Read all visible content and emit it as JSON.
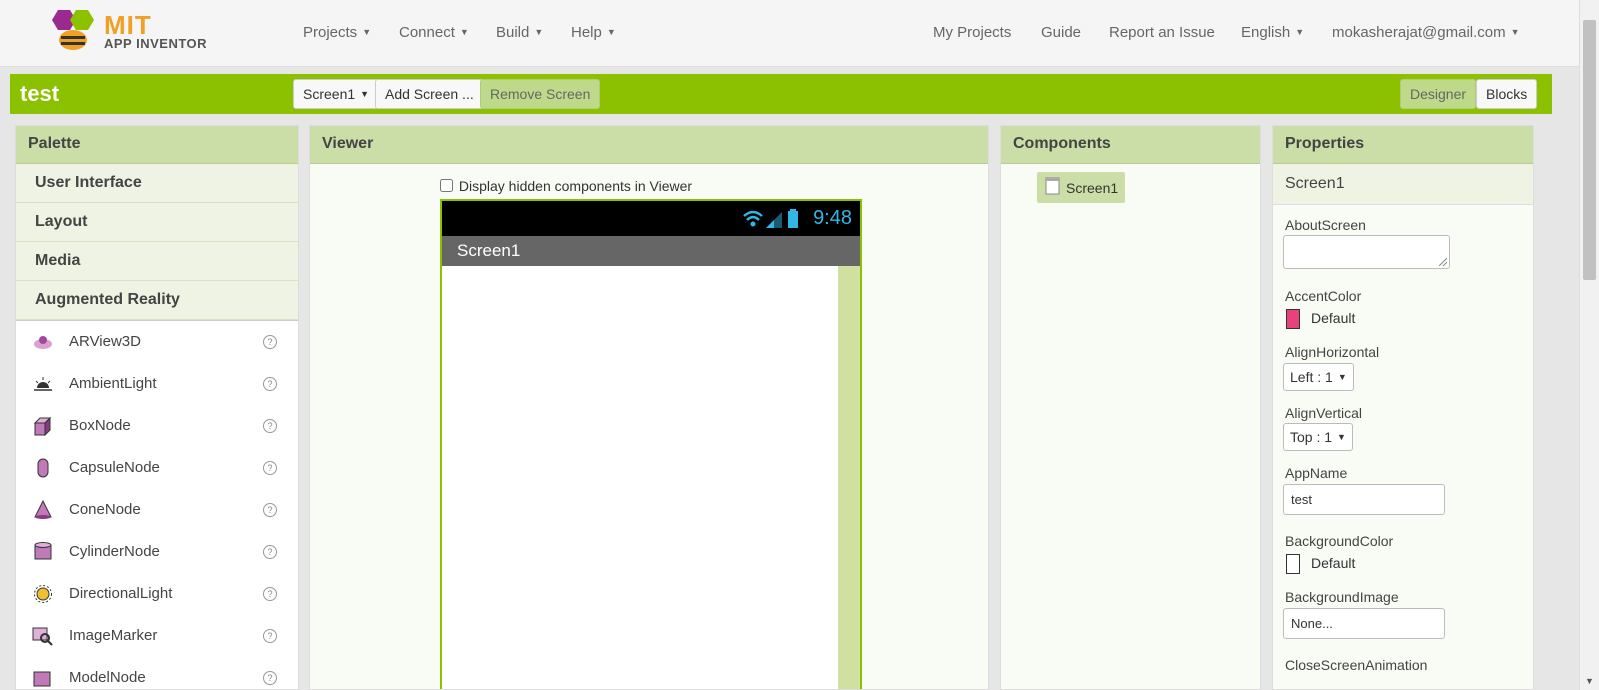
{
  "logo": {
    "line1": "MIT",
    "line2": "APP INVENTOR"
  },
  "nav": {
    "left": [
      "Projects",
      "Connect",
      "Build",
      "Help"
    ],
    "right": {
      "my_projects": "My Projects",
      "guide": "Guide",
      "report": "Report an Issue",
      "language": "English",
      "account": "mokasherajat@gmail.com"
    }
  },
  "project": {
    "title": "test",
    "screen_select": "Screen1",
    "add_screen": "Add Screen ...",
    "remove_screen": "Remove Screen",
    "designer": "Designer",
    "blocks": "Blocks"
  },
  "palette": {
    "title": "Palette",
    "categories": [
      "User Interface",
      "Layout",
      "Media",
      "Augmented Reality"
    ],
    "items": [
      {
        "label": "ARView3D",
        "icon": "arview3d-icon"
      },
      {
        "label": "AmbientLight",
        "icon": "ambientlight-icon"
      },
      {
        "label": "BoxNode",
        "icon": "boxnode-icon"
      },
      {
        "label": "CapsuleNode",
        "icon": "capsulenode-icon"
      },
      {
        "label": "ConeNode",
        "icon": "conenode-icon"
      },
      {
        "label": "CylinderNode",
        "icon": "cylindernode-icon"
      },
      {
        "label": "DirectionalLight",
        "icon": "directionallight-icon"
      },
      {
        "label": "ImageMarker",
        "icon": "imagemarker-icon"
      },
      {
        "label": "ModelNode",
        "icon": "modelnode-icon"
      }
    ],
    "help_glyph": "?"
  },
  "viewer": {
    "title": "Viewer",
    "hidden_label": "Display hidden components in Viewer",
    "clock": "9:48",
    "screen_title": "Screen1"
  },
  "components": {
    "title": "Components",
    "tree": [
      "Screen1"
    ]
  },
  "properties": {
    "title": "Properties",
    "component": "Screen1",
    "about_label": "AboutScreen",
    "accent_label": "AccentColor",
    "accent_value": "Default",
    "accent_color": "#e8427c",
    "alignh_label": "AlignHorizontal",
    "alignh_value": "Left : 1",
    "alignv_label": "AlignVertical",
    "alignv_value": "Top : 1",
    "appname_label": "AppName",
    "appname_value": "test",
    "bgcolor_label": "BackgroundColor",
    "bgcolor_value": "Default",
    "bgcolor_color": "#ffffff",
    "bgimage_label": "BackgroundImage",
    "bgimage_value": "None...",
    "closeanim_label": "CloseScreenAnimation"
  },
  "colors": {
    "brand_green": "#8cc100",
    "header_green": "#cbdea8"
  }
}
